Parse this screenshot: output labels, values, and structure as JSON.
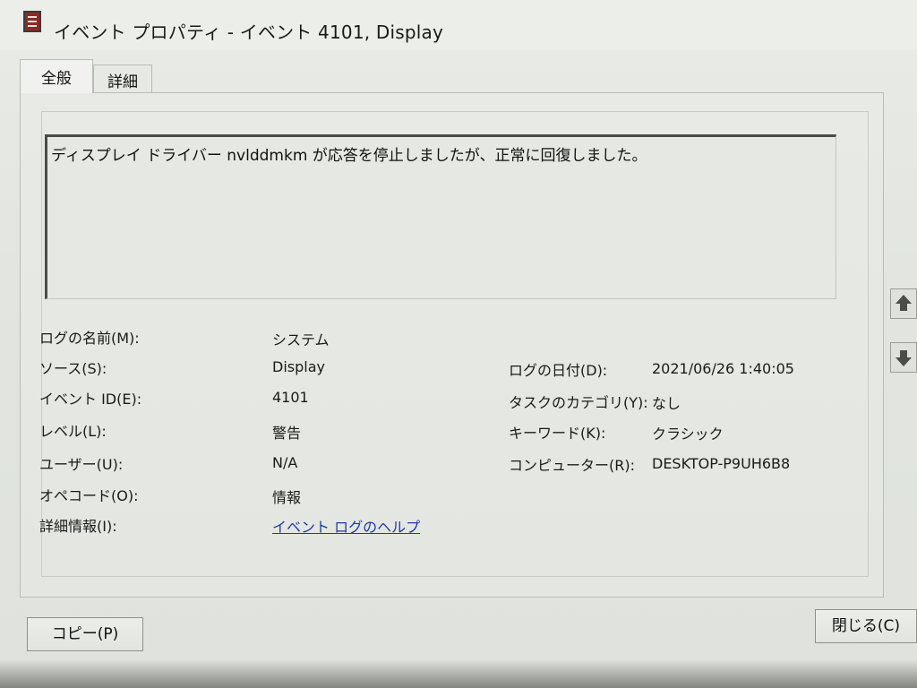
{
  "window": {
    "title": "イベント プロパティ - イベント 4101, Display"
  },
  "tabs": [
    {
      "label": "全般",
      "active": true
    },
    {
      "label": "詳細",
      "active": false
    }
  ],
  "message": "ディスプレイ ドライバー nvlddmkm が応答を停止しましたが、正常に回復しました。",
  "fields": {
    "log_name": {
      "label": "ログの名前(M):",
      "value": "システム"
    },
    "source": {
      "label": "ソース(S):",
      "value": "Display"
    },
    "event_id": {
      "label": "イベント ID(E):",
      "value": "4101"
    },
    "level": {
      "label": "レベル(L):",
      "value": "警告"
    },
    "user": {
      "label": "ユーザー(U):",
      "value": "N/A"
    },
    "opcode": {
      "label": "オペコード(O):",
      "value": "情報"
    },
    "more_info": {
      "label": "詳細情報(I):",
      "value": "イベント ログのヘルプ"
    },
    "logged": {
      "label": "ログの日付(D):",
      "value": "2021/06/26 1:40:05"
    },
    "task_category": {
      "label": "タスクのカテゴリ(Y):",
      "value": "なし"
    },
    "keywords": {
      "label": "キーワード(K):",
      "value": "クラシック"
    },
    "computer": {
      "label": "コンピューター(R):",
      "value": "DESKTOP-P9UH6B8"
    }
  },
  "buttons": {
    "copy": "コピー(P)",
    "close": "閉じる(C)"
  },
  "icons": {
    "app": "event-viewer-icon",
    "up": "arrow-up-icon",
    "down": "arrow-down-icon"
  }
}
